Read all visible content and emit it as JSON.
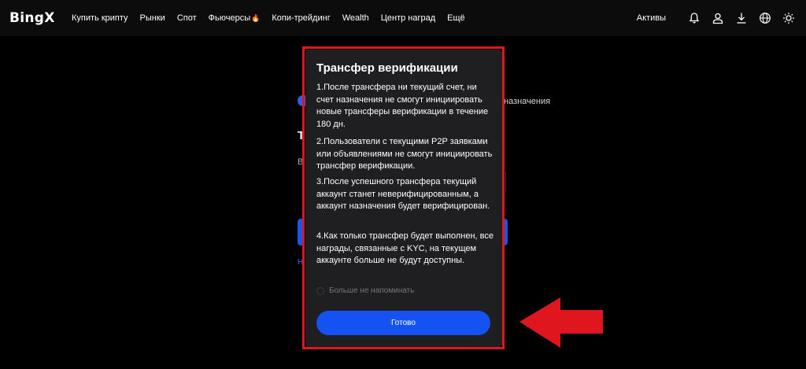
{
  "header": {
    "logo": "BingX",
    "nav": [
      {
        "label": "Купить крипту"
      },
      {
        "label": "Рынки"
      },
      {
        "label": "Спот"
      },
      {
        "label": "Фьючерсы",
        "badge": "🔥"
      },
      {
        "label": "Копи-трейдинг"
      },
      {
        "label": "Wealth"
      },
      {
        "label": "Центр наград"
      },
      {
        "label": "Ещё"
      }
    ],
    "assets_label": "Активы",
    "icons": [
      "bell-icon",
      "user-icon",
      "download-icon",
      "globe-icon",
      "sun-icon"
    ]
  },
  "background": {
    "fragment_right": "назначения",
    "fragment_t": "Т",
    "fragment_b": "В",
    "fragment_n": "Н"
  },
  "modal": {
    "title": "Трансфер верификации",
    "paragraphs": [
      "1.После трансфера ни текущий счет, ни счет назначения не смогут инициировать новые трансферы верификации в течение 180 дн.",
      "2.Пользователи с текущими P2P заявками или объявлениями не смогут инициировать трансфер верификации.",
      "3.После успешного трансфера текущий аккаунт станет неверифицированным, а аккаунт назначения будет верифицирован.",
      "4.Как только трансфер будет выполнен, все награды, связанные с KYC, на текущем аккаунте больше не будут доступны."
    ],
    "checkbox_label": "Больше не напоминать",
    "done_label": "Готово"
  },
  "colors": {
    "accent": "#1552f2",
    "highlight": "#e0161e",
    "modal_bg": "#1f1f21",
    "header_bg": "#0c0c0d"
  }
}
